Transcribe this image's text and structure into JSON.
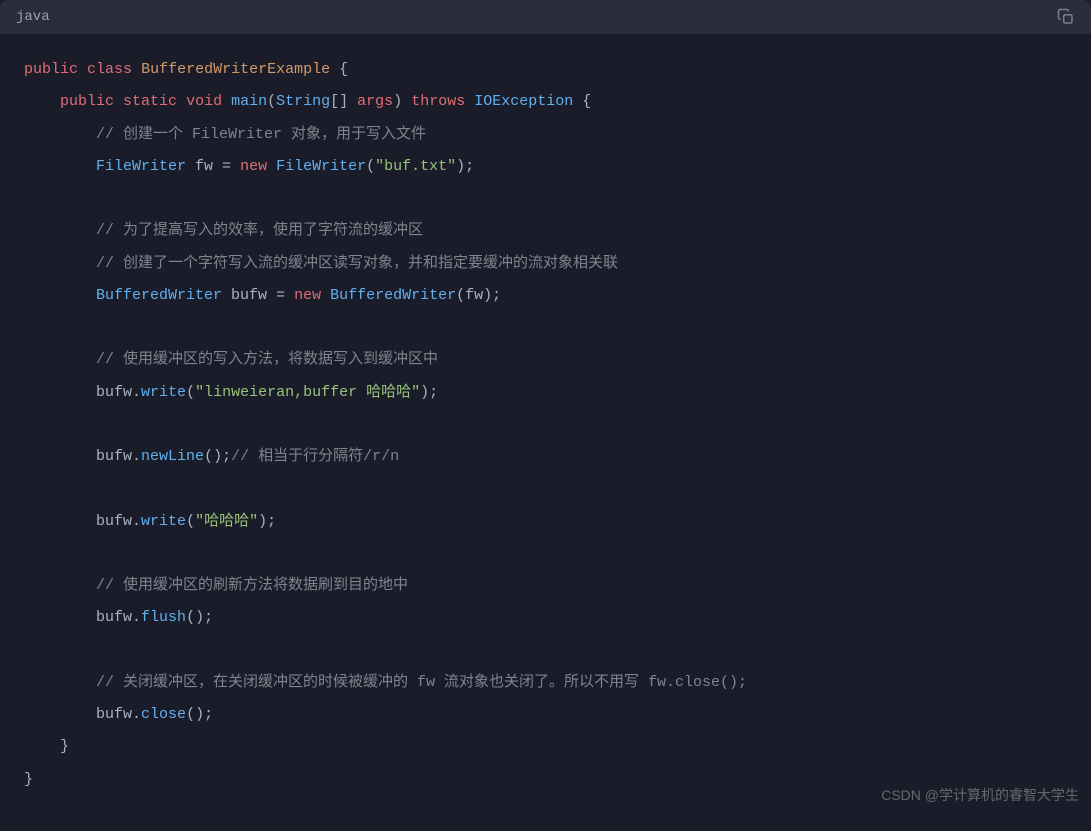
{
  "header": {
    "language": "java"
  },
  "watermark": "CSDN @学计算机的睿智大学生",
  "code": {
    "l1": {
      "kw1": "public",
      "kw2": "class",
      "cls": "BufferedWriterExample",
      "brace": " {"
    },
    "l2": {
      "indent": "    ",
      "kw1": "public",
      "kw2": "static",
      "kw3": "void",
      "method": "main",
      "paren1": "(",
      "type": "String",
      "arr": "[] ",
      "arg": "args",
      "paren2": ")",
      "kw4": " throws",
      "exc": " IOException",
      "brace": " {"
    },
    "l3": {
      "indent": "        ",
      "comment": "// 创建一个 FileWriter 对象，用于写入文件"
    },
    "l4": {
      "indent": "        ",
      "type": "FileWriter",
      "var": " fw ",
      "eq": "= ",
      "kw": "new",
      "ctor": " FileWriter",
      "paren1": "(",
      "str": "\"buf.txt\"",
      "paren2": ");"
    },
    "l5": {
      "blank": ""
    },
    "l6": {
      "indent": "        ",
      "comment": "// 为了提高写入的效率，使用了字符流的缓冲区"
    },
    "l7": {
      "indent": "        ",
      "comment": "// 创建了一个字符写入流的缓冲区读写对象，并和指定要缓冲的流对象相关联"
    },
    "l8": {
      "indent": "        ",
      "type": "BufferedWriter",
      "var": " bufw ",
      "eq": "= ",
      "kw": "new",
      "ctor": " BufferedWriter",
      "paren1": "(",
      "arg": "fw",
      "paren2": ");"
    },
    "l9": {
      "blank": ""
    },
    "l10": {
      "indent": "        ",
      "comment": "// 使用缓冲区的写入方法，将数据写入到缓冲区中"
    },
    "l11": {
      "indent": "        ",
      "var": "bufw",
      "dot": ".",
      "method": "write",
      "paren1": "(",
      "str": "\"linweieran,buffer 哈哈哈\"",
      "paren2": ");"
    },
    "l12": {
      "blank": ""
    },
    "l13": {
      "indent": "        ",
      "var": "bufw",
      "dot": ".",
      "method": "newLine",
      "paren": "();",
      "comment": "// 相当于行分隔符/r/n"
    },
    "l14": {
      "blank": ""
    },
    "l15": {
      "indent": "        ",
      "var": "bufw",
      "dot": ".",
      "method": "write",
      "paren1": "(",
      "str": "\"哈哈哈\"",
      "paren2": ");"
    },
    "l16": {
      "blank": ""
    },
    "l17": {
      "indent": "        ",
      "comment": "// 使用缓冲区的刷新方法将数据刷到目的地中"
    },
    "l18": {
      "indent": "        ",
      "var": "bufw",
      "dot": ".",
      "method": "flush",
      "paren": "();"
    },
    "l19": {
      "blank": ""
    },
    "l20": {
      "indent": "        ",
      "comment": "// 关闭缓冲区，在关闭缓冲区的时候被缓冲的 fw 流对象也关闭了。所以不用写 fw.close();"
    },
    "l21": {
      "indent": "        ",
      "var": "bufw",
      "dot": ".",
      "method": "close",
      "paren": "();"
    },
    "l22": {
      "indent": "    ",
      "brace": "}"
    },
    "l23": {
      "brace": "}"
    }
  }
}
